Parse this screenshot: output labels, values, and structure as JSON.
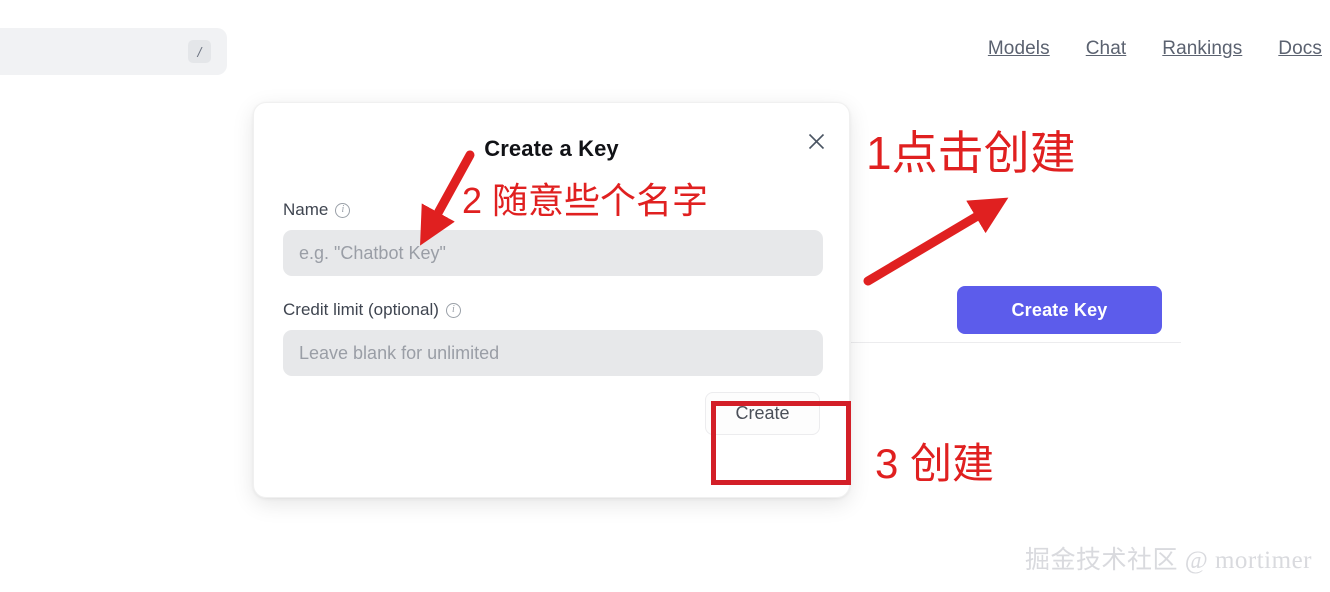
{
  "topbar": {
    "search": {
      "placeholder": "",
      "value": "",
      "shortcut_badge": "/"
    },
    "nav_items": [
      {
        "label": "Models"
      },
      {
        "label": "Chat"
      },
      {
        "label": "Rankings"
      },
      {
        "label": "Docs"
      }
    ]
  },
  "page": {
    "create_key_button_label": "Create Key",
    "accent_color": "#5c5ceb"
  },
  "modal": {
    "title": "Create a Key",
    "close_icon": "close-icon",
    "fields": [
      {
        "label": "Name",
        "info_icon": "info-icon",
        "placeholder": "e.g. \"Chatbot Key\"",
        "value": ""
      },
      {
        "label": "Credit limit (optional)",
        "info_icon": "info-icon",
        "placeholder": "Leave blank for unlimited",
        "value": ""
      }
    ],
    "submit_label": "Create"
  },
  "annotations": {
    "color": "#e02020",
    "highlight_color": "#d31f28",
    "step_1": "1点击创建",
    "step_2": "2 随意些个名字",
    "step_3": "3 创建"
  },
  "watermark": {
    "text": "掘金技术社区 @ mortimer"
  }
}
